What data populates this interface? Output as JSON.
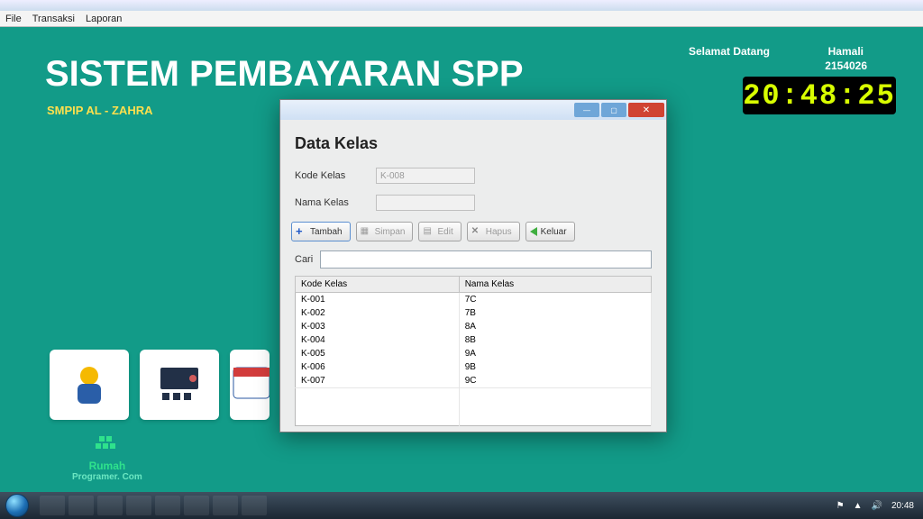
{
  "menubar": {
    "file": "File",
    "transaksi": "Transaksi",
    "laporan": "Laporan"
  },
  "header": {
    "title": "SISTEM PEMBAYARAN SPP",
    "subtitle": "SMPIP AL - ZAHRA",
    "welcome": "Selamat Datang",
    "username": "Hamali",
    "userid": "2154026",
    "clock": "20:48:25"
  },
  "modal": {
    "title": "Data Kelas",
    "kode_label": "Kode Kelas",
    "kode_value": "K-008",
    "nama_label": "Nama Kelas",
    "nama_value": "",
    "btn_tambah": "Tambah",
    "btn_simpan": "Simpan",
    "btn_edit": "Edit",
    "btn_hapus": "Hapus",
    "btn_keluar": "Keluar",
    "cari_label": "Cari",
    "cari_value": "",
    "col_kode": "Kode Kelas",
    "col_nama": "Nama Kelas",
    "rows": [
      {
        "kode": "K-001",
        "nama": "7C"
      },
      {
        "kode": "K-002",
        "nama": "7B"
      },
      {
        "kode": "K-003",
        "nama": "8A"
      },
      {
        "kode": "K-004",
        "nama": "8B"
      },
      {
        "kode": "K-005",
        "nama": "9A"
      },
      {
        "kode": "K-006",
        "nama": "9B"
      },
      {
        "kode": "K-007",
        "nama": "9C"
      }
    ]
  },
  "footer": {
    "brand": "Rumah",
    "tag": "Programer. Com"
  },
  "taskbar": {
    "time": "20:48"
  }
}
